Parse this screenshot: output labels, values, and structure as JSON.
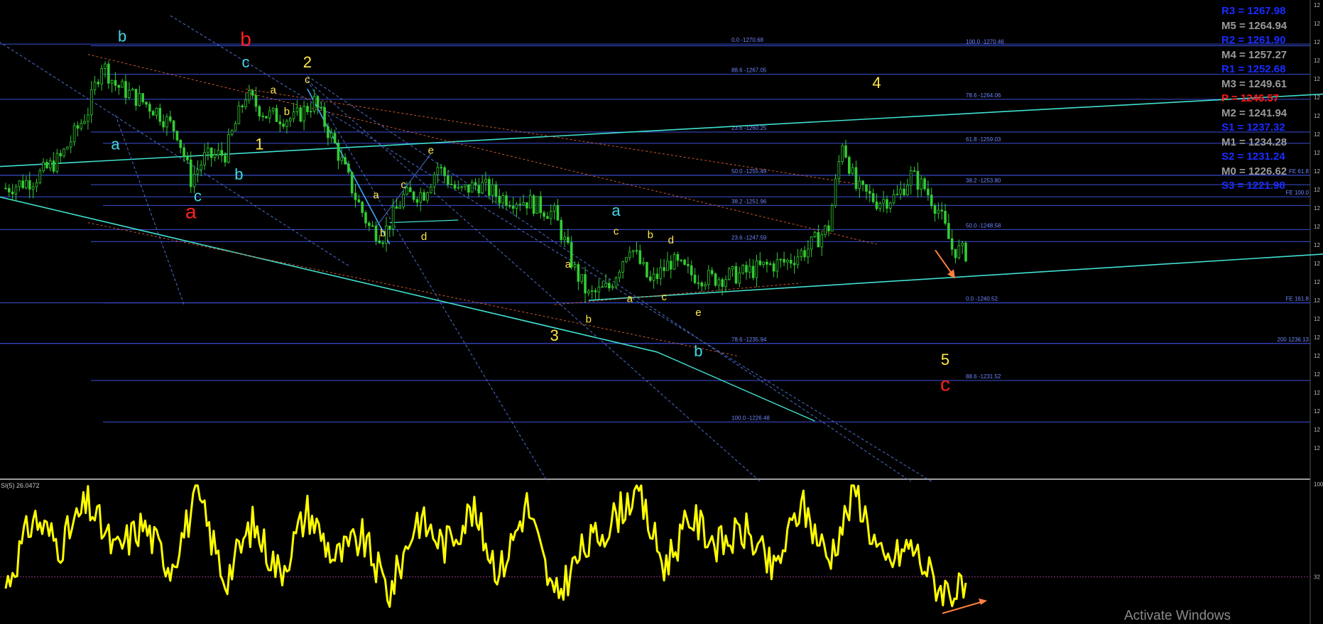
{
  "colors": {
    "background": "#000000",
    "candle": "#33cc33",
    "hline": "#3b4fd6",
    "trend_cyan": "#40e0d0",
    "trend_red": "#c8582e",
    "fan_blue": "#4a6ecf",
    "wave_yellow": "#ffe94a",
    "wave_cyan": "#40d8e8",
    "wave_red": "#ff2020",
    "rsi": "#ffff00",
    "arrow": "#ff8040",
    "level_text": "#6f86ff"
  },
  "pivots": [
    {
      "text": "R3 = 1267.98",
      "color": "#1a2cff"
    },
    {
      "text": "M5 = 1264.94",
      "color": "#9a9a9a"
    },
    {
      "text": "R2 = 1261.90",
      "color": "#1a2cff"
    },
    {
      "text": "M4 = 1257.27",
      "color": "#9a9a9a"
    },
    {
      "text": "R1 = 1252.68",
      "color": "#1a2cff"
    },
    {
      "text": "M3 = 1249.61",
      "color": "#9a9a9a"
    },
    {
      "text": "P = 1246.57",
      "color": "#ff1a1a"
    },
    {
      "text": "M2 = 1241.94",
      "color": "#9a9a9a"
    },
    {
      "text": "S1 = 1237.32",
      "color": "#1a2cff"
    },
    {
      "text": "M1 = 1234.28",
      "color": "#9a9a9a"
    },
    {
      "text": "S2 = 1231.24",
      "color": "#1a2cff"
    },
    {
      "text": "M0 = 1226.62",
      "color": "#9a9a9a"
    },
    {
      "text": "S3 = 1221.98",
      "color": "#1a2cff"
    }
  ],
  "rsi_label": "SI(5) 26.0472",
  "watermark": "Activate Windows",
  "right_axis_stub": "12",
  "rsi_axis": [
    "100",
    "32"
  ],
  "chart_data": [
    {
      "type": "candlestick",
      "title": "",
      "x_unit": "bar index",
      "y_unit": "price",
      "ylim": [
        1221.5,
        1274
      ],
      "close_path": [
        {
          "x": 0,
          "y": 1254.0
        },
        {
          "x": 4,
          "y": 1255.0
        },
        {
          "x": 8,
          "y": 1257.5
        },
        {
          "x": 12,
          "y": 1263.0
        },
        {
          "x": 14,
          "y": 1268.5
        },
        {
          "x": 16,
          "y": 1266.0
        },
        {
          "x": 19,
          "y": 1264.5
        },
        {
          "x": 22,
          "y": 1263.0
        },
        {
          "x": 25,
          "y": 1260.5
        },
        {
          "x": 27,
          "y": 1255.0
        },
        {
          "x": 29,
          "y": 1257.5
        },
        {
          "x": 32,
          "y": 1258.0
        },
        {
          "x": 35,
          "y": 1264.8
        },
        {
          "x": 38,
          "y": 1262.5
        },
        {
          "x": 42,
          "y": 1262.0
        },
        {
          "x": 45,
          "y": 1264.0
        },
        {
          "x": 48,
          "y": 1259.0
        },
        {
          "x": 51,
          "y": 1253.0
        },
        {
          "x": 53,
          "y": 1249.5
        },
        {
          "x": 55,
          "y": 1248.5
        },
        {
          "x": 58,
          "y": 1253.0
        },
        {
          "x": 61,
          "y": 1253.5
        },
        {
          "x": 63,
          "y": 1256.5
        },
        {
          "x": 66,
          "y": 1253.5
        },
        {
          "x": 69,
          "y": 1254.5
        },
        {
          "x": 72,
          "y": 1253.0
        },
        {
          "x": 76,
          "y": 1252.5
        },
        {
          "x": 80,
          "y": 1251.0
        },
        {
          "x": 83,
          "y": 1244.5
        },
        {
          "x": 85,
          "y": 1241.5
        },
        {
          "x": 88,
          "y": 1242.5
        },
        {
          "x": 91,
          "y": 1247.5
        },
        {
          "x": 94,
          "y": 1243.0
        },
        {
          "x": 97,
          "y": 1245.5
        },
        {
          "x": 100,
          "y": 1244.0
        },
        {
          "x": 103,
          "y": 1243.5
        },
        {
          "x": 107,
          "y": 1244.0
        },
        {
          "x": 111,
          "y": 1245.0
        },
        {
          "x": 114,
          "y": 1245.5
        },
        {
          "x": 117,
          "y": 1247.0
        },
        {
          "x": 120,
          "y": 1249.5
        },
        {
          "x": 122,
          "y": 1259.5
        },
        {
          "x": 124,
          "y": 1254.0
        },
        {
          "x": 127,
          "y": 1252.5
        },
        {
          "x": 130,
          "y": 1253.0
        },
        {
          "x": 132,
          "y": 1255.5
        },
        {
          "x": 134,
          "y": 1254.0
        },
        {
          "x": 136,
          "y": 1251.5
        },
        {
          "x": 138,
          "y": 1247.0
        },
        {
          "x": 140,
          "y": 1246.5
        }
      ],
      "levels": [
        {
          "label": "0.0 -1270.68",
          "value": 1270.7
        },
        {
          "label": "100.0 -1270.46",
          "value": 1270.5
        },
        {
          "label": "88.6 -1267.05",
          "value": 1267.2
        },
        {
          "label": "78.6 -1264.06",
          "value": 1264.3
        },
        {
          "label": "23.6 -1260.25",
          "value": 1260.5
        },
        {
          "label": "61.8 -1259.03",
          "value": 1259.2
        },
        {
          "label": "50.0 -1255.49",
          "value": 1255.5
        },
        {
          "label": "38.2 -1253.80",
          "value": 1254.4
        },
        {
          "label": "38.2 -1251.96",
          "value": 1252.0
        },
        {
          "label": "50.0 -1248.58",
          "value": 1249.2
        },
        {
          "label": "23.6 -1247.59",
          "value": 1247.8
        },
        {
          "label": "0.0 -1240.52",
          "value": 1240.7
        },
        {
          "label": "78.6 -1235.94",
          "value": 1236.0
        },
        {
          "label": "88.6 -1231.52",
          "value": 1231.7
        },
        {
          "label": "100.0 -1226.48",
          "value": 1226.9
        }
      ],
      "right_labels": [
        {
          "label": "FE 61.8",
          "value": 1255.5
        },
        {
          "label": "FE 100.0",
          "value": 1253.0
        },
        {
          "label": "FE 161.8",
          "value": 1240.7
        },
        {
          "label": "200 1236.13",
          "value": 1236.0
        }
      ],
      "wave_labels": [
        {
          "text": "b",
          "color": "#ff2020",
          "x": 35,
          "y": 1270.5
        },
        {
          "text": "a",
          "color": "#ff2020",
          "x": 27,
          "y": 1250.5
        },
        {
          "text": "c",
          "color": "#ff2020",
          "x": 137,
          "y": 1230.5
        },
        {
          "text": "b",
          "color": "#40d8e8",
          "x": 17,
          "y": 1271.0
        },
        {
          "text": "c",
          "color": "#40d8e8",
          "x": 35,
          "y": 1268.0
        },
        {
          "text": "a",
          "color": "#40d8e8",
          "x": 16,
          "y": 1258.5
        },
        {
          "text": "b",
          "color": "#40d8e8",
          "x": 34,
          "y": 1255.0
        },
        {
          "text": "c",
          "color": "#40d8e8",
          "x": 28,
          "y": 1252.5
        },
        {
          "text": "a",
          "color": "#40d8e8",
          "x": 89,
          "y": 1250.8
        },
        {
          "text": "b",
          "color": "#40d8e8",
          "x": 101,
          "y": 1234.5
        },
        {
          "text": "2",
          "color": "#ffe94a",
          "x": 44,
          "y": 1268.0
        },
        {
          "text": "1",
          "color": "#ffe94a",
          "x": 37,
          "y": 1258.5
        },
        {
          "text": "3",
          "color": "#ffe94a",
          "x": 80,
          "y": 1236.3
        },
        {
          "text": "4",
          "color": "#ffe94a",
          "x": 127,
          "y": 1265.6
        },
        {
          "text": "5",
          "color": "#ffe94a",
          "x": 137,
          "y": 1233.5
        },
        {
          "text": "c",
          "color": "#ffe94a",
          "x": 44,
          "y": 1266.2
        },
        {
          "text": "a",
          "color": "#ffe94a",
          "x": 39,
          "y": 1265.0
        },
        {
          "text": "b",
          "color": "#ffe94a",
          "x": 41,
          "y": 1262.5
        },
        {
          "text": "a",
          "color": "#ffe94a",
          "x": 54,
          "y": 1252.8
        },
        {
          "text": "c",
          "color": "#ffe94a",
          "x": 58,
          "y": 1254.0
        },
        {
          "text": "e",
          "color": "#ffe94a",
          "x": 62,
          "y": 1258.0
        },
        {
          "text": "b",
          "color": "#ffe94a",
          "x": 55,
          "y": 1248.4
        },
        {
          "text": "d",
          "color": "#ffe94a",
          "x": 61,
          "y": 1248.0
        },
        {
          "text": "a",
          "color": "#ffe94a",
          "x": 82,
          "y": 1244.8
        },
        {
          "text": "b",
          "color": "#ffe94a",
          "x": 85,
          "y": 1238.4
        },
        {
          "text": "c",
          "color": "#ffe94a",
          "x": 89,
          "y": 1248.6
        },
        {
          "text": "b",
          "color": "#ffe94a",
          "x": 94,
          "y": 1248.2
        },
        {
          "text": "d",
          "color": "#ffe94a",
          "x": 97,
          "y": 1247.6
        },
        {
          "text": "a",
          "color": "#ffe94a",
          "x": 91,
          "y": 1240.8
        },
        {
          "text": "c",
          "color": "#ffe94a",
          "x": 96,
          "y": 1241.0
        },
        {
          "text": "e",
          "color": "#ffe94a",
          "x": 101,
          "y": 1239.2
        }
      ]
    },
    {
      "type": "line",
      "title": "",
      "series": [
        {
          "name": "SI(5)",
          "x": [
            0,
            4,
            8,
            12,
            16,
            20,
            24,
            28,
            32,
            36,
            40,
            44,
            48,
            52,
            56,
            60,
            64,
            68,
            72,
            76,
            80,
            84,
            88,
            92,
            96,
            100,
            104,
            108,
            112,
            116,
            120,
            124,
            128,
            132,
            136,
            140
          ],
          "values": [
            25,
            75,
            55,
            85,
            50,
            70,
            40,
            90,
            30,
            70,
            35,
            80,
            45,
            60,
            20,
            75,
            55,
            80,
            35,
            85,
            15,
            50,
            70,
            95,
            40,
            75,
            55,
            65,
            35,
            85,
            45,
            95,
            40,
            55,
            25,
            20
          ]
        }
      ],
      "ylim": [
        0,
        100
      ],
      "reference_line": 32
    }
  ]
}
